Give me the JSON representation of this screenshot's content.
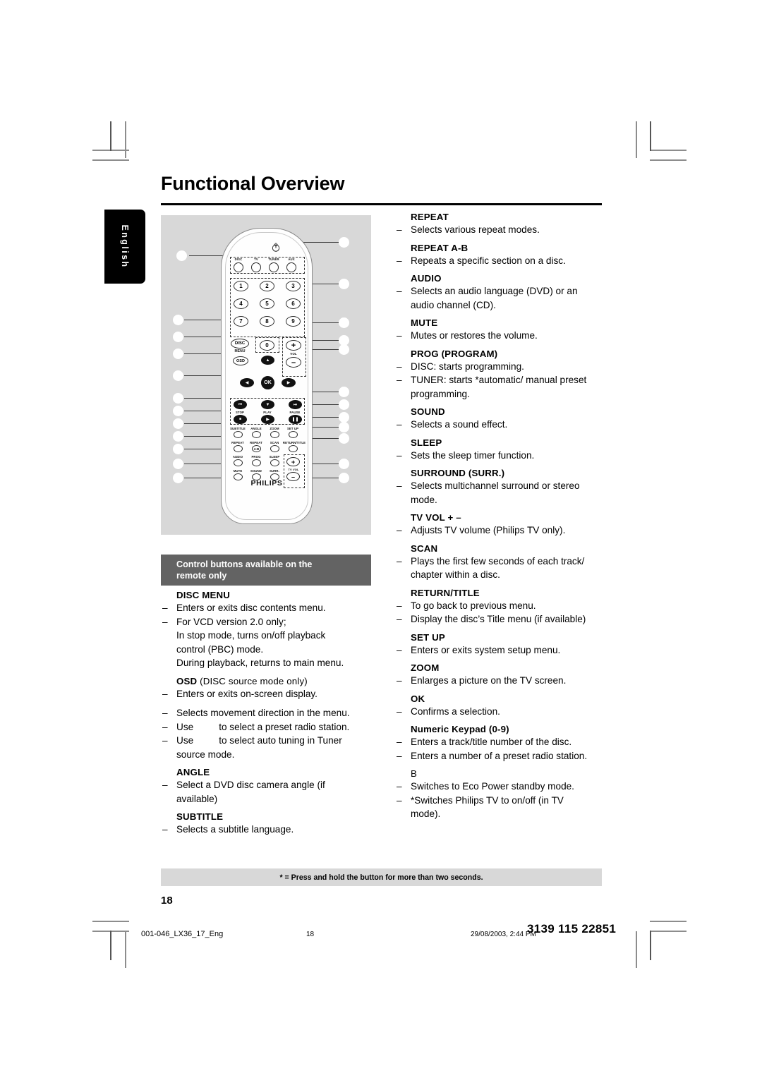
{
  "page": {
    "title": "Functional Overview",
    "language_tab": "English",
    "folio": "18"
  },
  "figure": {
    "brand_logo": "PHILIPS",
    "source_buttons": [
      "DISC",
      "TV",
      "TUNER",
      "AUX"
    ],
    "numeric_keys": [
      "1",
      "2",
      "3",
      "4",
      "5",
      "6",
      "7",
      "8",
      "9",
      "0"
    ],
    "disc_menu_label": "DISC",
    "disc_menu_sub": "MENU",
    "osd_label": "OSD",
    "ok_label": "OK",
    "vol_label": "VOL",
    "vol_plus": "+",
    "vol_minus": "–",
    "transport_labels": [
      "STOP",
      "PLAY",
      "PAUSE"
    ],
    "feature_row1": [
      "SUBTITLE",
      "ANGLE",
      "ZOOM",
      "SET UP"
    ],
    "feature_row2": [
      "REPEAT",
      "REPEAT",
      "SCAN",
      "RETURN/TITLE"
    ],
    "repeat_ab_label": "A-B",
    "feature_row3": [
      "AUDIO",
      "PROG",
      "SLEEP"
    ],
    "feature_row4": [
      "MUTE",
      "SOUND",
      "SURR."
    ],
    "tv_vol_label": "TV VOL",
    "tv_vol_plus": "+",
    "tv_vol_minus": "–",
    "standby_icon": "power-standby-icon"
  },
  "remote_only": {
    "band_line1": "Control buttons available on the",
    "band_line2": "remote only"
  },
  "left_column": [
    {
      "title": "DISC MENU",
      "rows": [
        {
          "bullet": true,
          "text": "Enters or exits disc contents menu."
        },
        {
          "bullet": true,
          "text": "For VCD version 2.0 only;"
        },
        {
          "bullet": false,
          "text": "In stop mode, turns on/off playback"
        },
        {
          "bullet": false,
          "text": "control (PBC) mode."
        },
        {
          "bullet": false,
          "text": "During playback, returns to main menu."
        }
      ]
    },
    {
      "title": "OSD",
      "title_suffix": " (DISC source mode only)",
      "rows": [
        {
          "bullet": true,
          "text": "Enters or exits on-screen display."
        }
      ]
    },
    {
      "title": "",
      "rows": [
        {
          "bullet": true,
          "text": "Selects movement direction in the menu."
        },
        {
          "bullet": true,
          "text": "Use",
          "gap_after": true,
          "text2": "to select a preset radio station."
        },
        {
          "bullet": true,
          "text": "Use",
          "gap_after": true,
          "text2": "to select auto tuning in Tuner"
        },
        {
          "bullet": false,
          "text": "source mode."
        }
      ]
    },
    {
      "title": "ANGLE",
      "rows": [
        {
          "bullet": true,
          "text": "Select a DVD disc camera angle (if"
        },
        {
          "bullet": false,
          "text": "available)"
        }
      ]
    },
    {
      "title": "SUBTITLE",
      "rows": [
        {
          "bullet": true,
          "text": "Selects a subtitle language."
        }
      ]
    }
  ],
  "right_column": [
    {
      "title": "REPEAT",
      "rows": [
        {
          "bullet": true,
          "text": "Selects various repeat modes."
        }
      ]
    },
    {
      "title": "REPEAT A-B",
      "rows": [
        {
          "bullet": true,
          "text": "Repeats a specific section on a disc."
        }
      ]
    },
    {
      "title": "AUDIO",
      "rows": [
        {
          "bullet": true,
          "text": "Selects an audio language (DVD) or an"
        },
        {
          "bullet": false,
          "text": "audio channel (CD)."
        }
      ]
    },
    {
      "title": "MUTE",
      "rows": [
        {
          "bullet": true,
          "text": "Mutes or restores the volume."
        }
      ]
    },
    {
      "title": "PROG (PROGRAM)",
      "rows": [
        {
          "bullet": true,
          "text": "DISC: starts programming."
        },
        {
          "bullet": true,
          "text": "TUNER: starts *automatic/ manual preset"
        },
        {
          "bullet": false,
          "text": "programming."
        }
      ]
    },
    {
      "title": "SOUND",
      "rows": [
        {
          "bullet": true,
          "text": "Selects a sound effect."
        }
      ]
    },
    {
      "title": "SLEEP",
      "rows": [
        {
          "bullet": true,
          "text": "Sets the sleep timer function."
        }
      ]
    },
    {
      "title": "SURROUND (SURR.)",
      "rows": [
        {
          "bullet": true,
          "text": "Selects multichannel surround or stereo"
        },
        {
          "bullet": false,
          "text": "mode."
        }
      ]
    },
    {
      "title": "TV VOL + –",
      "rows": [
        {
          "bullet": true,
          "text": "Adjusts TV volume (Philips TV only)."
        }
      ]
    },
    {
      "title": "SCAN",
      "rows": [
        {
          "bullet": true,
          "text": "Plays the first few seconds of each track/"
        },
        {
          "bullet": false,
          "text": "chapter within a disc."
        }
      ]
    },
    {
      "title": "RETURN/TITLE",
      "rows": [
        {
          "bullet": true,
          "text": "To go back to previous menu."
        },
        {
          "bullet": true,
          "text": "Display the disc’s Title menu (if available)"
        }
      ]
    },
    {
      "title": "SET UP",
      "rows": [
        {
          "bullet": true,
          "text": "Enters or exits system setup menu."
        }
      ]
    },
    {
      "title": "ZOOM",
      "rows": [
        {
          "bullet": true,
          "text": "Enlarges a picture on the TV screen."
        }
      ]
    },
    {
      "title": "OK",
      "rows": [
        {
          "bullet": true,
          "text": "Confirms a selection."
        }
      ]
    },
    {
      "title": "Numeric Keypad (0-9)",
      "title_style": "mixed",
      "rows": [
        {
          "bullet": true,
          "text": "Enters a track/title number of the disc."
        },
        {
          "bullet": true,
          "text": "Enters a number of a preset radio station."
        }
      ]
    },
    {
      "title": "B",
      "title_style": "regular",
      "rows": [
        {
          "bullet": true,
          "text": "Switches to Eco Power standby mode."
        },
        {
          "bullet": true,
          "text": "*Switches Philips TV to on/off (in TV"
        },
        {
          "bullet": false,
          "text": "mode)."
        }
      ]
    }
  ],
  "footnote": "* = Press and hold the button for more than two seconds.",
  "print_slug": {
    "filename": "001-046_LX36_17_Eng",
    "page": "18",
    "date": "29/08/2003, 2:44 PM",
    "doc_code": "3139 115 22851"
  },
  "colors": {
    "band_gray": "#636363",
    "panel_gray": "#d8d8d8",
    "rule_black": "#000000"
  }
}
